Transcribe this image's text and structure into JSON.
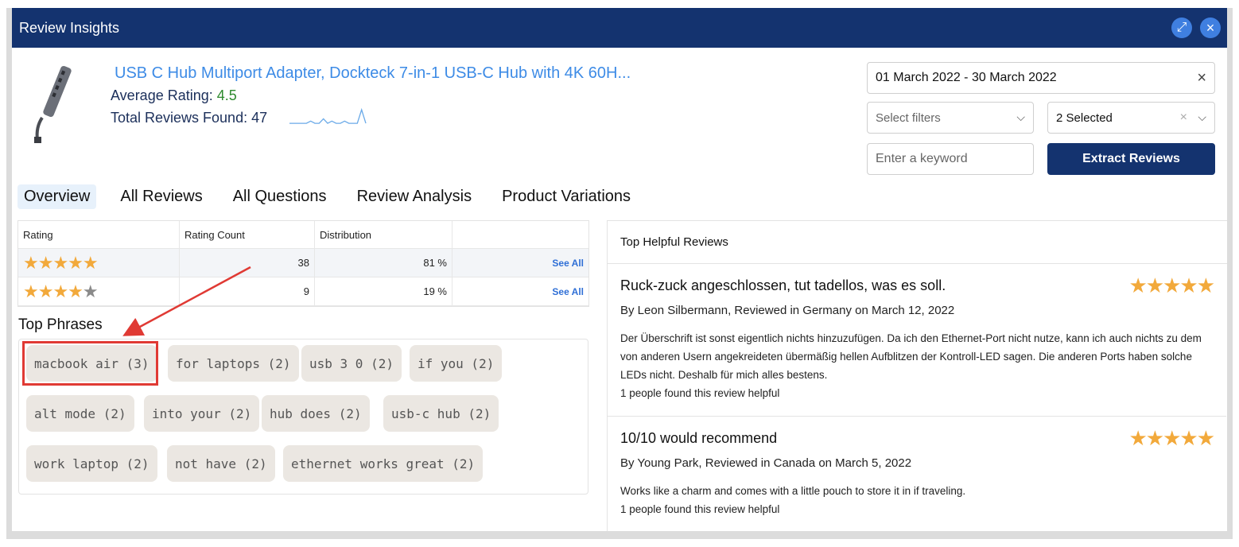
{
  "window": {
    "title": "Review Insights",
    "expand_icon": "expand-icon",
    "close_icon": "close-icon"
  },
  "product": {
    "title": "USB C Hub Multiport Adapter, Dockteck 7-in-1 USB-C Hub with 4K 60H...",
    "avg_rating_label": "Average Rating:",
    "avg_rating_value": "4.5",
    "total_reviews_label": "Total Reviews Found:",
    "total_reviews_value": "47",
    "sparkline_values": [
      1,
      1,
      1,
      1,
      1,
      2,
      1,
      1,
      3,
      1,
      2,
      1,
      1,
      2,
      1,
      1,
      1,
      7,
      1
    ]
  },
  "filters": {
    "date_range": "01 March 2022 - 30 March 2022",
    "select_filters_placeholder": "Select filters",
    "multi_select_value": "2 Selected",
    "keyword_placeholder": "Enter a keyword",
    "extract_label": "Extract Reviews"
  },
  "tabs": [
    {
      "label": "Overview",
      "active": true
    },
    {
      "label": "All Reviews",
      "active": false
    },
    {
      "label": "All Questions",
      "active": false
    },
    {
      "label": "Review Analysis",
      "active": false
    },
    {
      "label": "Product Variations",
      "active": false
    }
  ],
  "rating_table": {
    "headers": [
      "Rating",
      "Rating Count",
      "Distribution",
      ""
    ],
    "rows": [
      {
        "stars": 5,
        "count": "38",
        "distribution": "81 %",
        "action": "See All"
      },
      {
        "stars": 4,
        "count": "9",
        "distribution": "19 %",
        "action": "See All"
      }
    ]
  },
  "top_phrases": {
    "title": "Top Phrases",
    "items": [
      "macbook air (3)",
      "for laptops (2)",
      "usb 3 0 (2)",
      "if you (2)",
      "alt mode (2)",
      "into your (2)",
      "hub does (2)",
      "usb-c hub (2)",
      "work laptop (2)",
      "not have (2)",
      "ethernet works great (2)"
    ]
  },
  "helpful_reviews": {
    "title": "Top Helpful Reviews",
    "reviews": [
      {
        "title": "Ruck-zuck angeschlossen, tut tadellos, was es soll.",
        "stars": 5,
        "byline": "By Leon Silbermann, Reviewed in Germany on March 12, 2022",
        "body": "Der Überschrift ist sonst eigentlich nichts hinzuzufügen. Da ich den Ethernet-Port nicht nutze, kann ich auch nichts zu dem von anderen Usern angekreideten übermäßig hellen Aufblitzen der Kontroll-LED sagen. Die anderen Ports haben solche LEDs nicht. Deshalb für mich alles bestens.",
        "helpful": "1 people found this review helpful"
      },
      {
        "title": "10/10 would recommend",
        "stars": 5,
        "byline": "By Young Park, Reviewed in Canada on March 5, 2022",
        "body": "Works like a charm and comes with a little pouch to store it in if traveling.",
        "helpful": "1 people found this review helpful"
      }
    ]
  },
  "colors": {
    "titlebar": "#14336f",
    "link": "#3d8be6",
    "star": "#f2a93b",
    "highlight": "#e03a34"
  }
}
